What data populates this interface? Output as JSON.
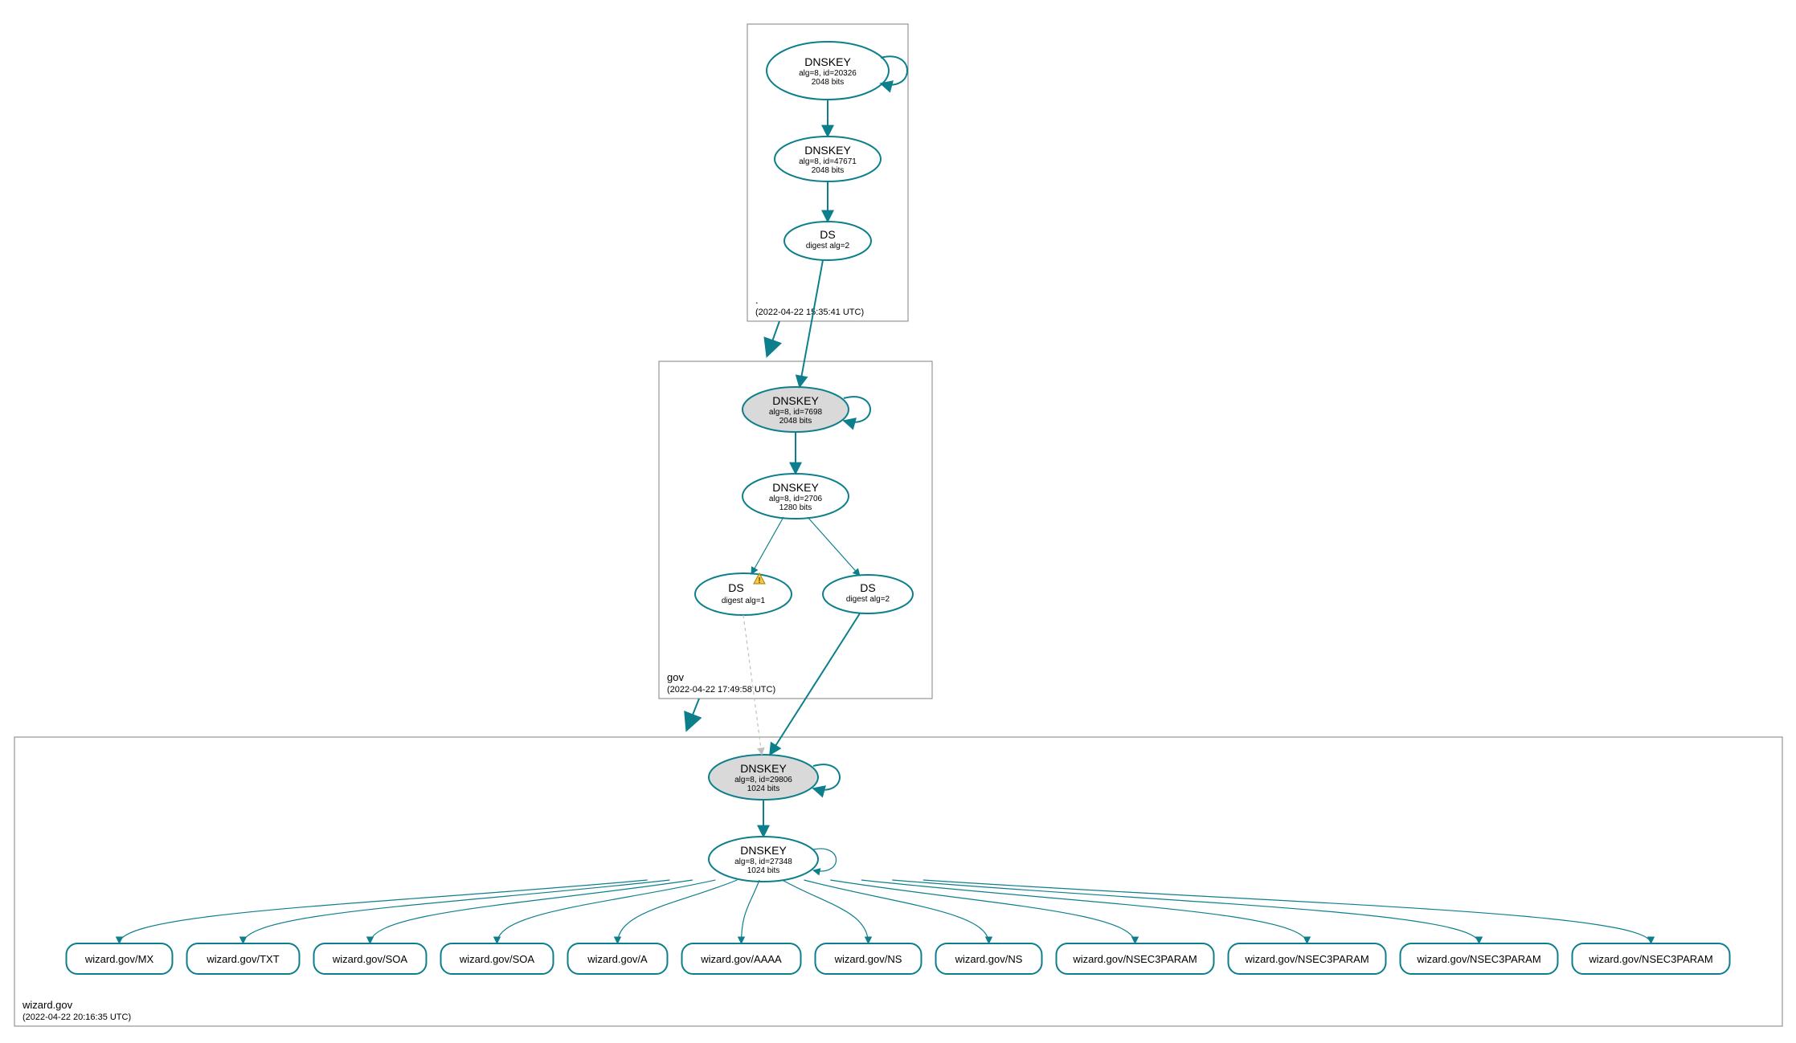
{
  "colors": {
    "accent": "#0d7f8c",
    "node_grey": "#d9d9d9",
    "warn": "#f7c948"
  },
  "zones": {
    "root": {
      "name": ".",
      "timestamp": "(2022-04-22 15:35:41 UTC)"
    },
    "gov": {
      "name": "gov",
      "timestamp": "(2022-04-22 17:49:58 UTC)"
    },
    "wizard": {
      "name": "wizard.gov",
      "timestamp": "(2022-04-22 20:16:35 UTC)"
    }
  },
  "nodes": {
    "root_ksk": {
      "title": "DNSKEY",
      "line2": "alg=8, id=20326",
      "line3": "2048 bits"
    },
    "root_zsk": {
      "title": "DNSKEY",
      "line2": "alg=8, id=47671",
      "line3": "2048 bits"
    },
    "root_ds": {
      "title": "DS",
      "line2": "digest alg=2",
      "line3": ""
    },
    "gov_ksk": {
      "title": "DNSKEY",
      "line2": "alg=8, id=7698",
      "line3": "2048 bits"
    },
    "gov_zsk": {
      "title": "DNSKEY",
      "line2": "alg=8, id=2706",
      "line3": "1280 bits"
    },
    "gov_ds1": {
      "title": "DS",
      "line2": "digest alg=1",
      "line3": "",
      "warn": true
    },
    "gov_ds2": {
      "title": "DS",
      "line2": "digest alg=2",
      "line3": ""
    },
    "wiz_ksk": {
      "title": "DNSKEY",
      "line2": "alg=8, id=29806",
      "line3": "1024 bits"
    },
    "wiz_zsk": {
      "title": "DNSKEY",
      "line2": "alg=8, id=27348",
      "line3": "1024 bits"
    }
  },
  "leaves": [
    "wizard.gov/MX",
    "wizard.gov/TXT",
    "wizard.gov/SOA",
    "wizard.gov/SOA",
    "wizard.gov/A",
    "wizard.gov/AAAA",
    "wizard.gov/NS",
    "wizard.gov/NS",
    "wizard.gov/NSEC3PARAM",
    "wizard.gov/NSEC3PARAM",
    "wizard.gov/NSEC3PARAM",
    "wizard.gov/NSEC3PARAM"
  ]
}
